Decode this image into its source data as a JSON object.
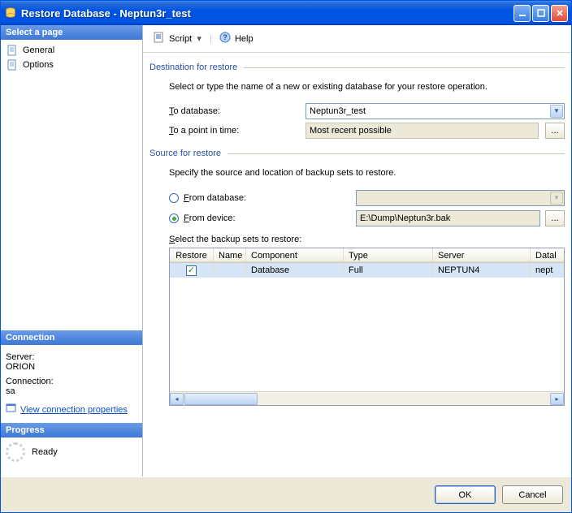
{
  "window": {
    "title": "Restore Database - Neptun3r_test"
  },
  "sidebar": {
    "select_page": "Select a page",
    "pages": [
      "General",
      "Options"
    ],
    "connection_hdr": "Connection",
    "server_lbl": "Server:",
    "server_val": "ORION",
    "conn_lbl": "Connection:",
    "conn_val": "sa",
    "view_props": "View connection properties",
    "progress_hdr": "Progress",
    "progress_val": "Ready"
  },
  "toolbar": {
    "script": "Script",
    "help": "Help"
  },
  "dest": {
    "title": "Destination for restore",
    "desc": "Select or type the name of a new or existing database for your restore operation.",
    "to_db_prefix": "T",
    "to_db_suffix": "o database:",
    "to_db_value": "Neptun3r_test",
    "to_time_prefix": "T",
    "to_time_suffix": "o a point in time:",
    "to_time_value": "Most recent possible"
  },
  "source": {
    "title": "Source for restore",
    "desc": "Specify the source and location of backup sets to restore.",
    "from_db_prefix": "F",
    "from_db_suffix": "rom database:",
    "from_dev_prefix": "F",
    "from_dev_suffix": "rom device:",
    "device_value": "E:\\Dump\\Neptun3r.bak",
    "select_sets_prefix": "S",
    "select_sets_suffix": "elect the backup sets to restore:"
  },
  "table": {
    "headers": {
      "restore": "Restore",
      "name": "Name",
      "component": "Component",
      "type": "Type",
      "server": "Server",
      "database": "Datal"
    },
    "rows": [
      {
        "restore": true,
        "name": "",
        "component": "Database",
        "type": "Full",
        "server": "NEPTUN4",
        "database": "nept"
      }
    ]
  },
  "footer": {
    "ok": "OK",
    "cancel": "Cancel"
  }
}
